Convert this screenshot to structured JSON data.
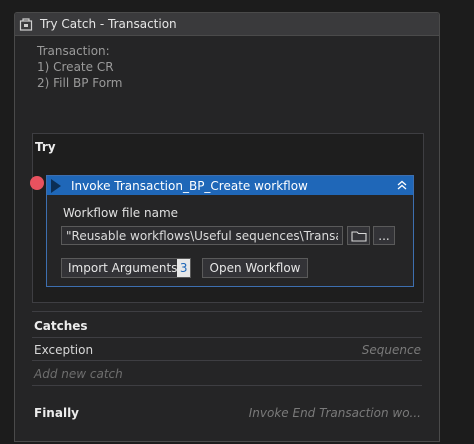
{
  "window": {
    "title": "Try Catch - Transaction",
    "icon": "try-catch-icon"
  },
  "annotation": {
    "lines": [
      "Transaction:",
      "1) Create CR",
      "2) Fill BP Form"
    ]
  },
  "try_section": {
    "title": "Try",
    "activity": {
      "title": "Invoke Transaction_BP_Create workflow",
      "workflow_label": "Workflow file name",
      "workflow_value": "\"Reusable workflows\\Useful sequences\\Transaction_BP",
      "browse_button_icon": "folder-icon",
      "more_button_label": "...",
      "import_label": "Import Arguments",
      "import_count": "3",
      "open_label": "Open Workflow"
    }
  },
  "catches": {
    "title": "Catches",
    "items": [
      {
        "exception": "Exception",
        "handler": "Sequence"
      }
    ],
    "add_label": "Add new catch"
  },
  "finally": {
    "title": "Finally",
    "hint": "Invoke End Transaction wo..."
  },
  "colors": {
    "accent": "#1f67b8",
    "breakpoint": "#e8525f",
    "background": "#252526"
  }
}
